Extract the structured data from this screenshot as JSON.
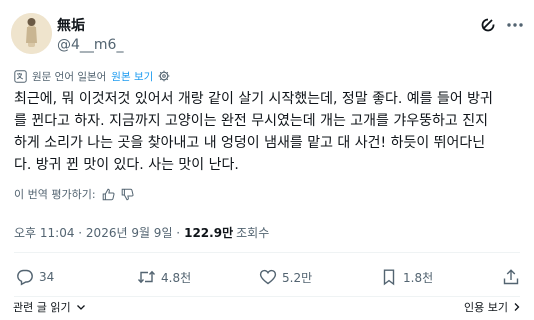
{
  "author": {
    "display_name": "無垢",
    "handle": "@4__m6_"
  },
  "translation": {
    "note": "원문 언어 일본어",
    "show_original": "원본 보기"
  },
  "tweet": {
    "lines": [
      "최근에, 뭐 이것저것 있어서 개랑 같이 살기 시작했는데, 정말 좋다. 예를 들어 방귀",
      "를 뀐다고 하자. 지금까지 고양이는 완전 무시였는데 개는 고개를 갸우뚱하고 진지",
      "하게 소리가 나는 곳을 찾아내고 내 엉덩이 냄새를 맡고 대 사건! 하듯이 뛰어다닌",
      "다. 방귀 뀐 맛이 있다. 사는 맛이 난다."
    ]
  },
  "rate_translation": "이 번역 평가하기:",
  "meta": {
    "timestamp": "오후 11:04 · 2026년 9월 9일 ·",
    "views_count": "122.9만",
    "views_label": "조회수"
  },
  "actions": {
    "replies": "34",
    "retweets": "4.8천",
    "likes": "5.2만",
    "views": "1.8천"
  },
  "footer": {
    "related_posts": "관련 글 읽기",
    "quotes": "인용 보기"
  },
  "colors": {
    "accent": "#1d9bf0",
    "muted": "#536471",
    "text": "#0f1419"
  }
}
